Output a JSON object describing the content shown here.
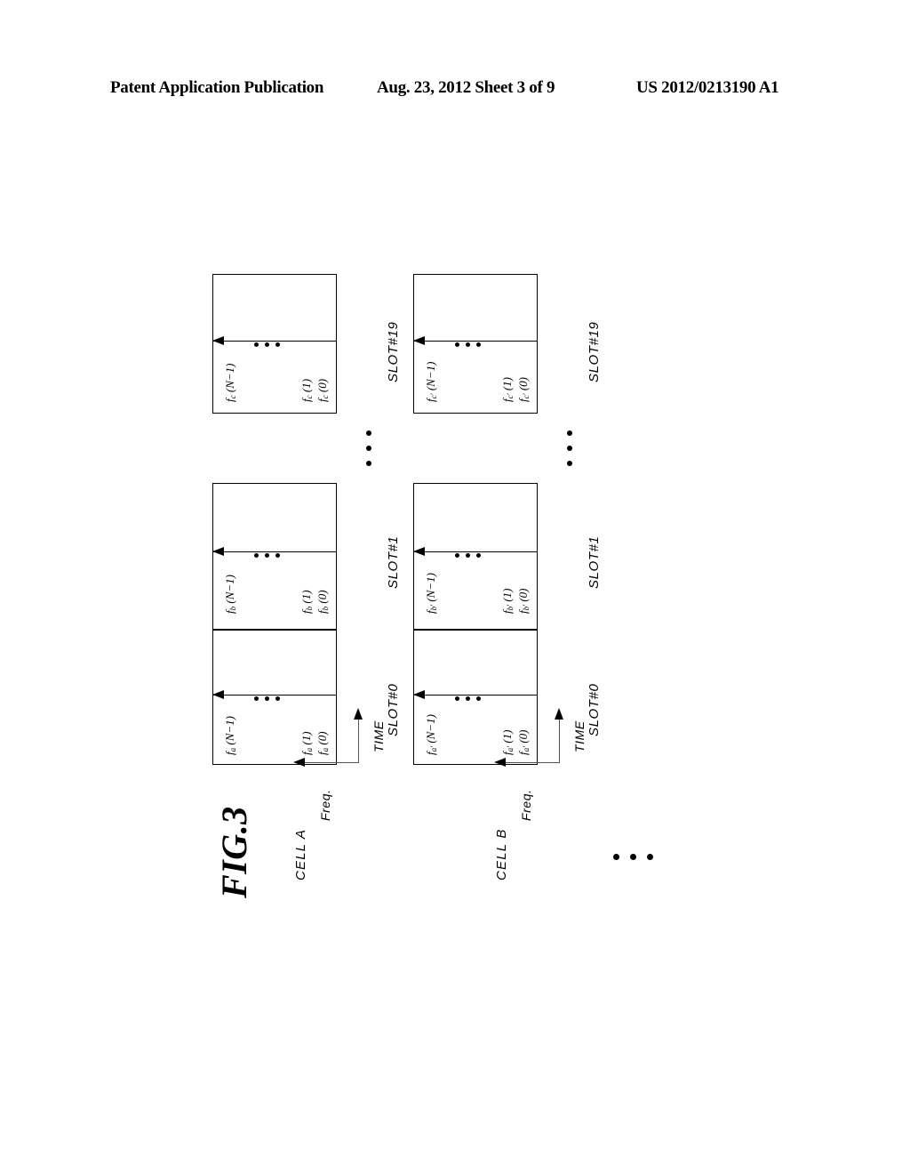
{
  "header": {
    "left": "Patent Application Publication",
    "middle": "Aug. 23, 2012  Sheet 3 of 9",
    "right": "US 2012/0213190 A1"
  },
  "figure": {
    "caption": "FIG.3",
    "axis_time_label": "TIME",
    "axis_freq_label": "Freq.",
    "more_cells_ellipsis": "• • •",
    "cells": [
      {
        "name": "CELL A",
        "slots": [
          {
            "caption": "SLOT#0",
            "top_label": "f",
            "top_sub": "a",
            "top_arg": " (N−1)",
            "mid_label": "f",
            "mid_sub": "a",
            "mid_arg": " (1)",
            "bot_label": "f",
            "bot_sub": "a",
            "bot_arg": " (0)"
          },
          {
            "caption": "SLOT#1",
            "top_label": "f",
            "top_sub": "b",
            "top_arg": " (N−1)",
            "mid_label": "f",
            "mid_sub": "b",
            "mid_arg": " (1)",
            "bot_label": "f",
            "bot_sub": "b",
            "bot_arg": " (0)"
          },
          {
            "caption": "SLOT#19",
            "top_label": "f",
            "top_sub": "c",
            "top_arg": " (N−1)",
            "mid_label": "f",
            "mid_sub": "c",
            "mid_arg": " (1)",
            "bot_label": "f",
            "bot_sub": "c",
            "bot_arg": " (0)"
          }
        ]
      },
      {
        "name": "CELL B",
        "slots": [
          {
            "caption": "SLOT#0",
            "top_label": "f",
            "top_sub": "a′",
            "top_arg": " (N−1)",
            "mid_label": "f",
            "mid_sub": "a′",
            "mid_arg": " (1)",
            "bot_label": "f",
            "bot_sub": "a′",
            "bot_arg": " (0)"
          },
          {
            "caption": "SLOT#1",
            "top_label": "f",
            "top_sub": "b′",
            "top_arg": " (N−1)",
            "mid_label": "f",
            "mid_sub": "b′",
            "mid_arg": " (1)",
            "bot_label": "f",
            "bot_sub": "b′",
            "bot_arg": " (0)"
          },
          {
            "caption": "SLOT#19",
            "top_label": "f",
            "top_sub": "c′",
            "top_arg": " (N−1)",
            "mid_label": "f",
            "mid_sub": "c′",
            "mid_arg": " (1)",
            "bot_label": "f",
            "bot_sub": "c′",
            "bot_arg": " (0)"
          }
        ]
      }
    ]
  }
}
